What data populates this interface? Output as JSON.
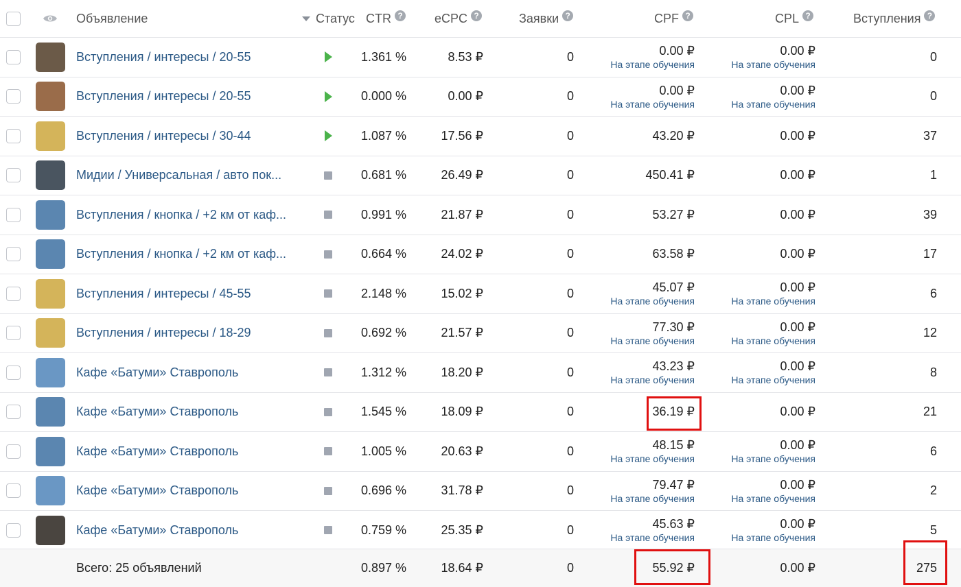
{
  "header": {
    "ad": "Объявление",
    "status": "Статус",
    "ctr": "CTR",
    "ecpc": "eCPC",
    "requests": "Заявки",
    "cpf": "CPF",
    "cpl": "CPL",
    "joins": "Вступления",
    "help_glyph": "?"
  },
  "icons": {
    "eye": "eye-icon",
    "sort": "sort-down-icon",
    "help": "question-icon",
    "play": "play-icon",
    "stop": "stop-icon"
  },
  "rows": [
    {
      "name": "Вступления / интересы / 20-55",
      "status": "play",
      "ctr": "1.361 %",
      "ecpc": "8.53 ₽",
      "requests": "0",
      "cpf": "0.00 ₽",
      "cpf_note": "На этапе обучения",
      "cpl": "0.00 ₽",
      "cpl_note": "На этапе обучения",
      "joins": "0",
      "thumb_color": "#6b5a48"
    },
    {
      "name": "Вступления / интересы / 20-55",
      "status": "play",
      "ctr": "0.000 %",
      "ecpc": "0.00 ₽",
      "requests": "0",
      "cpf": "0.00 ₽",
      "cpf_note": "На этапе обучения",
      "cpl": "0.00 ₽",
      "cpl_note": "На этапе обучения",
      "joins": "0",
      "thumb_color": "#9a6c4a"
    },
    {
      "name": "Вступления / интересы / 30-44",
      "status": "play",
      "ctr": "1.087 %",
      "ecpc": "17.56 ₽",
      "requests": "0",
      "cpf": "43.20 ₽",
      "cpf_note": "",
      "cpl": "0.00 ₽",
      "cpl_note": "",
      "joins": "37",
      "thumb_color": "#d4b45a"
    },
    {
      "name": "Мидии / Универсальная / авто пок...",
      "status": "stop",
      "ctr": "0.681 %",
      "ecpc": "26.49 ₽",
      "requests": "0",
      "cpf": "450.41 ₽",
      "cpf_note": "",
      "cpl": "0.00 ₽",
      "cpl_note": "",
      "joins": "1",
      "thumb_color": "#4a5560"
    },
    {
      "name": "Вступления / кнопка / +2 км от каф...",
      "status": "stop",
      "ctr": "0.991 %",
      "ecpc": "21.87 ₽",
      "requests": "0",
      "cpf": "53.27 ₽",
      "cpf_note": "",
      "cpl": "0.00 ₽",
      "cpl_note": "",
      "joins": "39",
      "thumb_color": "#5b86b0"
    },
    {
      "name": "Вступления / кнопка / +2 км от каф...",
      "status": "stop",
      "ctr": "0.664 %",
      "ecpc": "24.02 ₽",
      "requests": "0",
      "cpf": "63.58 ₽",
      "cpf_note": "",
      "cpl": "0.00 ₽",
      "cpl_note": "",
      "joins": "17",
      "thumb_color": "#5b86b0"
    },
    {
      "name": "Вступления / интересы / 45-55",
      "status": "stop",
      "ctr": "2.148 %",
      "ecpc": "15.02 ₽",
      "requests": "0",
      "cpf": "45.07 ₽",
      "cpf_note": "На этапе обучения",
      "cpl": "0.00 ₽",
      "cpl_note": "На этапе обучения",
      "joins": "6",
      "thumb_color": "#d4b45a"
    },
    {
      "name": "Вступления / интересы / 18-29",
      "status": "stop",
      "ctr": "0.692 %",
      "ecpc": "21.57 ₽",
      "requests": "0",
      "cpf": "77.30 ₽",
      "cpf_note": "На этапе обучения",
      "cpl": "0.00 ₽",
      "cpl_note": "На этапе обучения",
      "joins": "12",
      "thumb_color": "#d4b45a"
    },
    {
      "name": "Кафе «Батуми» Ставрополь",
      "status": "stop",
      "ctr": "1.312 %",
      "ecpc": "18.20 ₽",
      "requests": "0",
      "cpf": "43.23 ₽",
      "cpf_note": "На этапе обучения",
      "cpl": "0.00 ₽",
      "cpl_note": "На этапе обучения",
      "joins": "8",
      "thumb_color": "#6a97c4"
    },
    {
      "name": "Кафе «Батуми» Ставрополь",
      "status": "stop",
      "ctr": "1.545 %",
      "ecpc": "18.09 ₽",
      "requests": "0",
      "cpf": "36.19 ₽",
      "cpf_note": "",
      "cpl": "0.00 ₽",
      "cpl_note": "",
      "joins": "21",
      "thumb_color": "#5b86b0"
    },
    {
      "name": "Кафе «Батуми» Ставрополь",
      "status": "stop",
      "ctr": "1.005 %",
      "ecpc": "20.63 ₽",
      "requests": "0",
      "cpf": "48.15 ₽",
      "cpf_note": "На этапе обучения",
      "cpl": "0.00 ₽",
      "cpl_note": "На этапе обучения",
      "joins": "6",
      "thumb_color": "#5b86b0"
    },
    {
      "name": "Кафе «Батуми» Ставрополь",
      "status": "stop",
      "ctr": "0.696 %",
      "ecpc": "31.78 ₽",
      "requests": "0",
      "cpf": "79.47 ₽",
      "cpf_note": "На этапе обучения",
      "cpl": "0.00 ₽",
      "cpl_note": "На этапе обучения",
      "joins": "2",
      "thumb_color": "#6a97c4"
    },
    {
      "name": "Кафе «Батуми» Ставрополь",
      "status": "stop",
      "ctr": "0.759 %",
      "ecpc": "25.35 ₽",
      "requests": "0",
      "cpf": "45.63 ₽",
      "cpf_note": "На этапе обучения",
      "cpl": "0.00 ₽",
      "cpl_note": "На этапе обучения",
      "joins": "5",
      "thumb_color": "#4a4540"
    }
  ],
  "total": {
    "label": "Всего: 25 объявлений",
    "ctr": "0.897 %",
    "ecpc": "18.64 ₽",
    "requests": "0",
    "cpf": "55.92 ₽",
    "cpl": "0.00 ₽",
    "joins": "275"
  },
  "colors": {
    "link": "#2a5885",
    "play": "#4bb34b",
    "stop": "#a0a6b1",
    "highlight": "#e01010"
  }
}
